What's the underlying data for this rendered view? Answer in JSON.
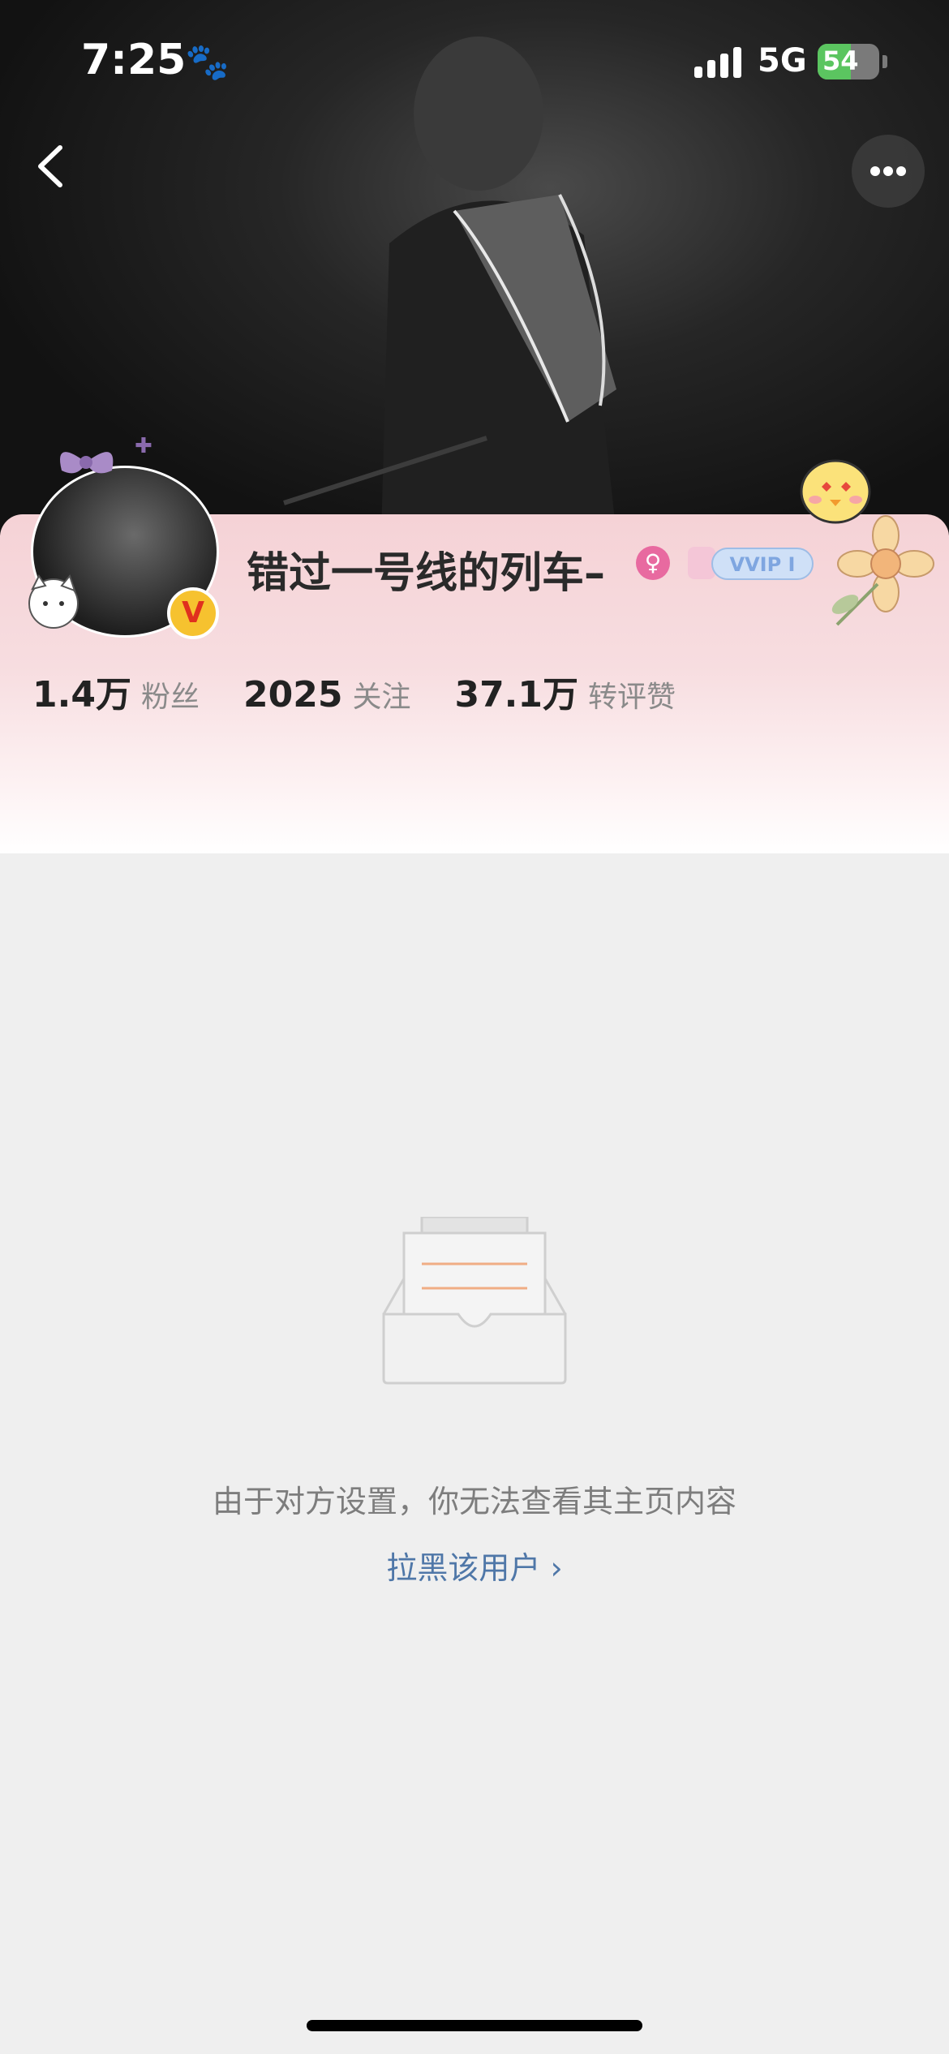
{
  "status_bar": {
    "time": "7:25",
    "network": "5G",
    "battery": "54",
    "battery_level": 0.54
  },
  "profile": {
    "username": "错过一号线的列车–",
    "gender_icon": "female-icon",
    "vip_badge": "VVIP I",
    "verified_badge": "V",
    "stats": [
      {
        "value": "1.4万",
        "label": "粉丝"
      },
      {
        "value": "2025",
        "label": "关注"
      },
      {
        "value": "37.1万",
        "label": "转评赞"
      }
    ]
  },
  "content": {
    "empty_message": "由于对方设置，你无法查看其主页内容",
    "block_link": "拉黑该用户 ›"
  },
  "colors": {
    "accent_link": "#4f77a8",
    "card_pink": "#f5d2d6",
    "background": "#efefef"
  }
}
